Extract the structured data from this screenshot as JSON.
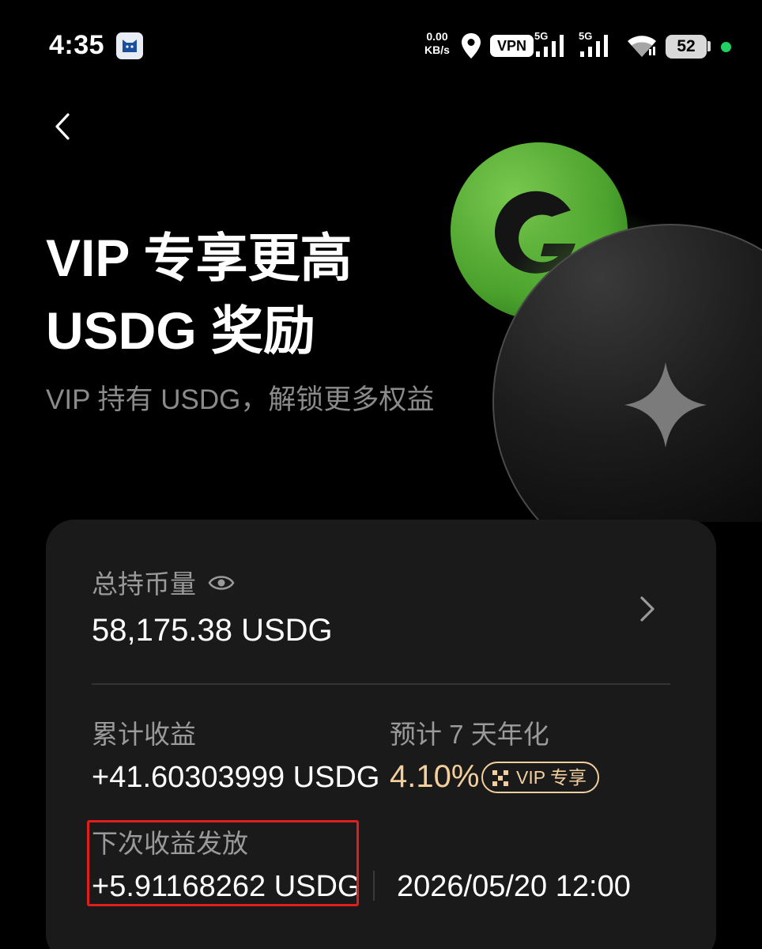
{
  "status_bar": {
    "time": "4:35",
    "net_speed_value": "0.00",
    "net_speed_unit": "KB/s",
    "vpn": "VPN",
    "signal1_label": "5G",
    "signal2_label": "5G",
    "battery": "52"
  },
  "header": {
    "title_line1": "VIP 专享更高",
    "title_line2": "USDG 奖励",
    "subtitle": "VIP 持有 USDG，解锁更多权益"
  },
  "card": {
    "holdings_label": "总持币量",
    "holdings_value": "58,175.38 USDG",
    "cumulative_label": "累计收益",
    "cumulative_value": "+41.60303999 USDG",
    "apy_label": "预计 7 天年化",
    "apy_value": "4.10%",
    "vip_badge": "VIP 专享",
    "next_label": "下次收益发放",
    "next_value": "+5.91168262 USDG",
    "next_time": "2026/05/20 12:00"
  },
  "colors": {
    "accent_gold": "#f2cf9d",
    "highlight_red": "#e11d1d",
    "coin_green": "#5bb23a"
  }
}
